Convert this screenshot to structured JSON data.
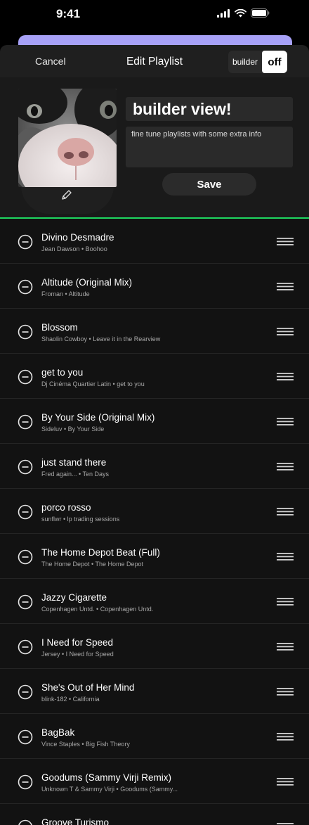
{
  "status_bar": {
    "time": "9:41"
  },
  "nav": {
    "cancel_label": "Cancel",
    "title": "Edit Playlist",
    "toggle_label": "builder",
    "toggle_state": "off"
  },
  "playlist": {
    "name": "builder view!",
    "description": "fine tune playlists with some extra info",
    "save_label": "Save"
  },
  "colors": {
    "accent": "#1ed760",
    "sheet_peek": "#a7a1f7",
    "background": "#121212"
  },
  "tracks": [
    {
      "title": "Divino Desmadre",
      "subtitle": "Jean Dawson • Boohoo"
    },
    {
      "title": "Altitude (Original Mix)",
      "subtitle": "Froman • Altitude"
    },
    {
      "title": "Blossom",
      "subtitle": "Shaolin Cowboy • Leave it in the Rearview"
    },
    {
      "title": "get to you",
      "subtitle": "Dj Cinéma Quartier Latin • get to you"
    },
    {
      "title": "By Your Side (Original Mix)",
      "subtitle": "Sideluv • By Your Side"
    },
    {
      "title": "just stand there",
      "subtitle": "Fred again... • Ten Days"
    },
    {
      "title": "porco rosso",
      "subtitle": "sunflwr • lp trading sessions"
    },
    {
      "title": "The Home Depot Beat (Full)",
      "subtitle": "The Home Depot • The Home Depot"
    },
    {
      "title": "Jazzy Cigarette",
      "subtitle": "Copenhagen Untd. • Copenhagen Untd."
    },
    {
      "title": "I Need for Speed",
      "subtitle": "Jersey • I Need for Speed"
    },
    {
      "title": "She's Out of Her Mind",
      "subtitle": "blink-182 • California"
    },
    {
      "title": "BagBak",
      "subtitle": "Vince Staples • Big Fish Theory"
    },
    {
      "title": "Goodums (Sammy Virji Remix)",
      "subtitle": "Unknown T & Sammy Virji • Goodums (Sammy..."
    },
    {
      "title": "Groove Turismo",
      "subtitle": ""
    }
  ]
}
